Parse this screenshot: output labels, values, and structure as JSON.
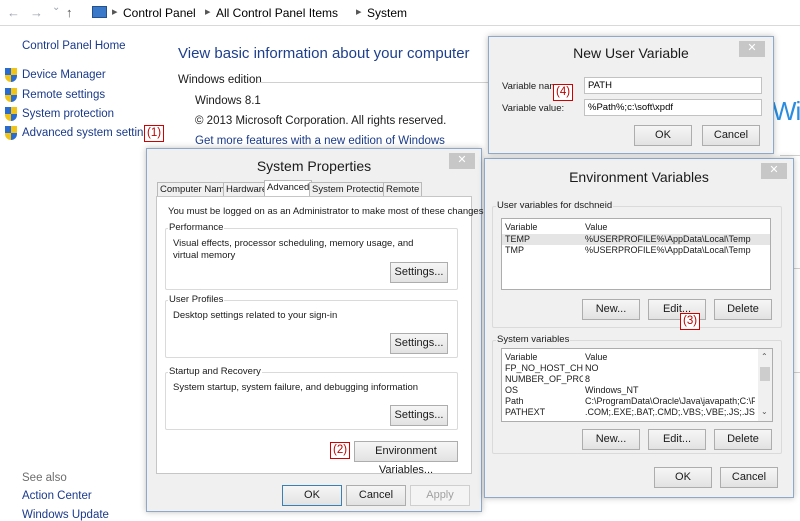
{
  "address_bar": {
    "back": "←",
    "forward": "→",
    "dropdown": "⌄",
    "up": "↑",
    "crumbs": [
      "Control Panel",
      "All Control Panel Items",
      "System"
    ],
    "sep": "▸"
  },
  "left_pane": {
    "home": "Control Panel Home",
    "links": [
      "Device Manager",
      "Remote settings",
      "System protection",
      "Advanced system settings"
    ],
    "see_also_heading": "See also",
    "see_also": [
      "Action Center",
      "Windows Update"
    ]
  },
  "main": {
    "title": "View basic information about your computer",
    "edition_heading": "Windows edition",
    "edition": "Windows 8.1",
    "copyright": "© 2013 Microsoft Corporation. All rights reserved.",
    "more_features_link": "Get more features with a new edition of Windows",
    "logo_text": "Wi"
  },
  "annotations": {
    "a1": "(1)",
    "a2": "(2)",
    "a3": "(3)",
    "a4": "(4)"
  },
  "system_properties": {
    "title": "System Properties",
    "close": "✕",
    "tabs": [
      "Computer Name",
      "Hardware",
      "Advanced",
      "System Protection",
      "Remote"
    ],
    "admin_note": "You must be logged on as an Administrator to make most of these changes.",
    "performance": {
      "label": "Performance",
      "text": "Visual effects, processor scheduling, memory usage, and virtual memory",
      "button": "Settings..."
    },
    "user_profiles": {
      "label": "User Profiles",
      "text": "Desktop settings related to your sign-in",
      "button": "Settings..."
    },
    "startup": {
      "label": "Startup and Recovery",
      "text": "System startup, system failure, and debugging information",
      "button": "Settings..."
    },
    "env_button": "Environment Variables...",
    "ok": "OK",
    "cancel": "Cancel",
    "apply": "Apply"
  },
  "new_user_variable": {
    "title": "New User Variable",
    "close": "✕",
    "name_label": "Variable name:",
    "name_value": "PATH",
    "value_label": "Variable value:",
    "value_value": "%Path%;c:\\soft\\xpdf",
    "ok": "OK",
    "cancel": "Cancel"
  },
  "environment_variables": {
    "title": "Environment Variables",
    "close": "✕",
    "user_heading": "User variables for dschneid",
    "col_variable": "Variable",
    "col_value": "Value",
    "user_rows": [
      {
        "name": "TEMP",
        "value": "%USERPROFILE%\\AppData\\Local\\Temp"
      },
      {
        "name": "TMP",
        "value": "%USERPROFILE%\\AppData\\Local\\Temp"
      }
    ],
    "user_new": "New...",
    "user_edit": "Edit...",
    "user_delete": "Delete",
    "system_heading": "System variables",
    "system_rows": [
      {
        "name": "FP_NO_HOST_CH...",
        "value": "NO"
      },
      {
        "name": "NUMBER_OF_PRO...",
        "value": "8"
      },
      {
        "name": "OS",
        "value": "Windows_NT"
      },
      {
        "name": "Path",
        "value": "C:\\ProgramData\\Oracle\\Java\\javapath;C:\\P..."
      },
      {
        "name": "PATHEXT",
        "value": ".COM;.EXE;.BAT;.CMD;.VBS;.VBE;.JS;.JSE;...."
      }
    ],
    "sys_new": "New...",
    "sys_edit": "Edit...",
    "sys_delete": "Delete",
    "ok": "OK",
    "cancel": "Cancel"
  }
}
